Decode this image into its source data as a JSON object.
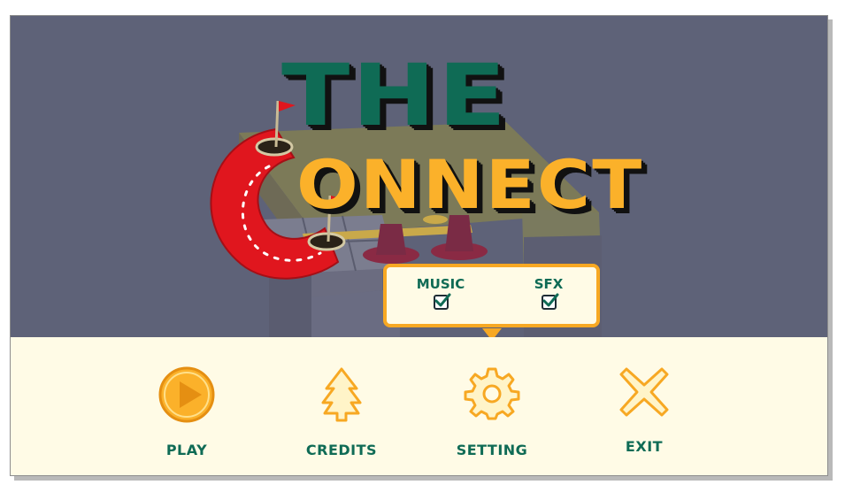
{
  "title": {
    "line1": "THE",
    "line2": "ONNECT"
  },
  "settings_popup": {
    "music": {
      "label": "MUSIC",
      "checked": true
    },
    "sfx": {
      "label": "SFX",
      "checked": true
    }
  },
  "menu": {
    "play": {
      "label": "PLAY",
      "icon": "play-icon"
    },
    "credits": {
      "label": "CREDITS",
      "icon": "tree-icon"
    },
    "setting": {
      "label": "SETTING",
      "icon": "gear-icon"
    },
    "exit": {
      "label": "EXIT",
      "icon": "close-icon"
    }
  },
  "colors": {
    "background": "#5e6278",
    "title_green": "#0f6b55",
    "title_orange": "#fbb12a",
    "accent_orange": "#f7a823",
    "panel_cream": "#fffbe6",
    "logo_red": "#e0161e"
  }
}
